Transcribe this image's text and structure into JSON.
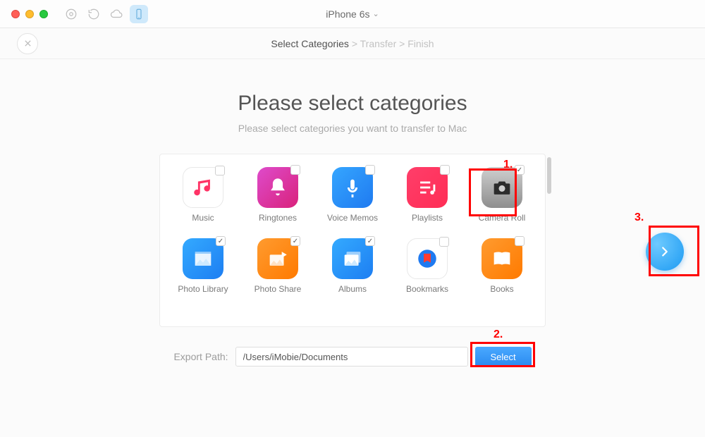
{
  "titlebar": {
    "device_label": "iPhone 6s"
  },
  "breadcrumb": {
    "step1": "Select Categories",
    "step2": "Transfer",
    "step3": "Finish",
    "sep": " > "
  },
  "heading": {
    "title": "Please select categories",
    "subtitle": "Please select categories you want to transfer to Mac"
  },
  "categories": {
    "music": {
      "label": "Music",
      "checked": false
    },
    "ringtones": {
      "label": "Ringtones",
      "checked": false
    },
    "voicememos": {
      "label": "Voice Memos",
      "checked": false
    },
    "playlists": {
      "label": "Playlists",
      "checked": false
    },
    "cameraroll": {
      "label": "Camera Roll",
      "checked": true
    },
    "photolibrary": {
      "label": "Photo Library",
      "checked": true
    },
    "photoshare": {
      "label": "Photo Share",
      "checked": true
    },
    "albums": {
      "label": "Albums",
      "checked": true
    },
    "bookmarks": {
      "label": "Bookmarks",
      "checked": false
    },
    "books": {
      "label": "Books",
      "checked": false
    }
  },
  "export": {
    "label": "Export Path:",
    "path": "/Users/iMobie/Documents",
    "select_label": "Select"
  },
  "annotations": {
    "n1": "1.",
    "n2": "2.",
    "n3": "3."
  }
}
